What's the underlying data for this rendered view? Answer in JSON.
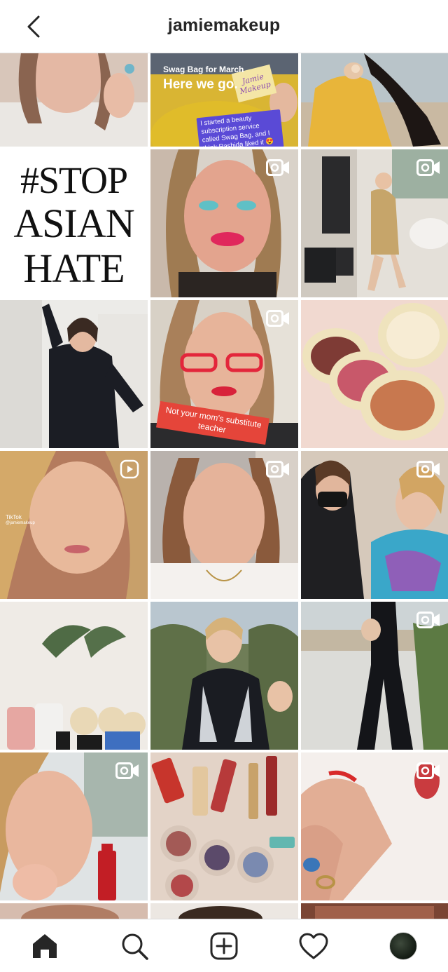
{
  "header": {
    "title": "jamiemakeup",
    "back_icon": "chevron-left-icon"
  },
  "posts": [
    {
      "type": "image",
      "bg": "#d9c8bd"
    },
    {
      "type": "image",
      "bg": "#d8b532",
      "title": "Swag Bag for March",
      "subtitle": "Here we go.",
      "sticker": "Jamie Makeup",
      "caption": "I started a beauty subscription service called Swag Bag, and I think Rashida liked it 😍"
    },
    {
      "type": "image",
      "bg": "#e7b33a"
    },
    {
      "type": "image",
      "bg": "#ffffff",
      "lines": [
        "#STOP",
        "ASIAN",
        "HATE"
      ]
    },
    {
      "type": "video",
      "bg": "#c7776b"
    },
    {
      "type": "video",
      "bg": "#d8d3cc"
    },
    {
      "type": "image",
      "bg": "#e6e4e0"
    },
    {
      "type": "video",
      "bg": "#b98a7a",
      "caption": "Not your mom's substitute teacher"
    },
    {
      "type": "image",
      "bg": "#f0d6cc"
    },
    {
      "type": "clip",
      "bg": "#c88f70",
      "badge": "TikTok",
      "handle": "@jamiemakeup"
    },
    {
      "type": "video",
      "bg": "#d2b9a9"
    },
    {
      "type": "video",
      "bg": "#8fa2b3"
    },
    {
      "type": "image",
      "bg": "#ece8e2"
    },
    {
      "type": "image",
      "bg": "#6e7a55"
    },
    {
      "type": "video",
      "bg": "#cfcac3"
    },
    {
      "type": "video",
      "bg": "#c6a99a"
    },
    {
      "type": "image",
      "bg": "#d8bfb0"
    },
    {
      "type": "video",
      "bg": "#e7dad4"
    },
    {
      "type": "image",
      "bg": "#d9c3bb"
    },
    {
      "type": "image",
      "bg": "#3a2a20"
    },
    {
      "type": "image",
      "bg": "#8a4a3c"
    }
  ],
  "nav": {
    "items": [
      {
        "icon": "home-icon"
      },
      {
        "icon": "search-icon"
      },
      {
        "icon": "new-post-icon"
      },
      {
        "icon": "heart-icon"
      },
      {
        "icon": "profile-avatar"
      }
    ]
  }
}
